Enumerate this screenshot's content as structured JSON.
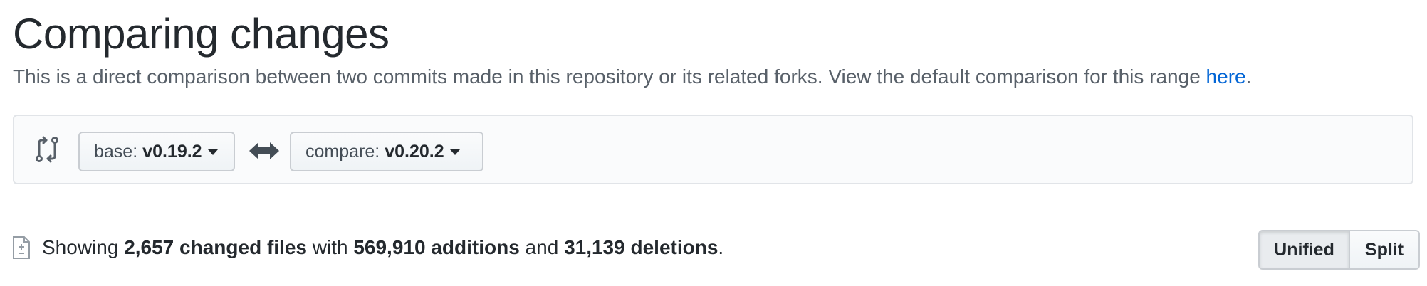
{
  "header": {
    "title": "Comparing changes",
    "description": "This is a direct comparison between two commits made in this repository or its related forks. View the default comparison for this range ",
    "link_text": "here",
    "description_end": "."
  },
  "range": {
    "base_prefix": "base:",
    "base_ref": "v0.19.2",
    "compare_prefix": "compare:",
    "compare_ref": "v0.20.2"
  },
  "summary": {
    "showing": "Showing ",
    "changed_files": "2,657 changed files",
    "with": " with ",
    "additions": "569,910 additions",
    "and": " and ",
    "deletions": "31,139 deletions",
    "end": "."
  },
  "view_toggle": {
    "unified": "Unified",
    "split": "Split",
    "selected": "unified"
  },
  "icons": {
    "compare": "git-compare-icon",
    "arrows": "arrow-both-icon",
    "file": "file-diff-icon"
  },
  "colors": {
    "link": "#0366d6",
    "text": "#24292e",
    "muted": "#586069",
    "box_bg": "#fafbfc",
    "border": "#e1e4e8"
  }
}
